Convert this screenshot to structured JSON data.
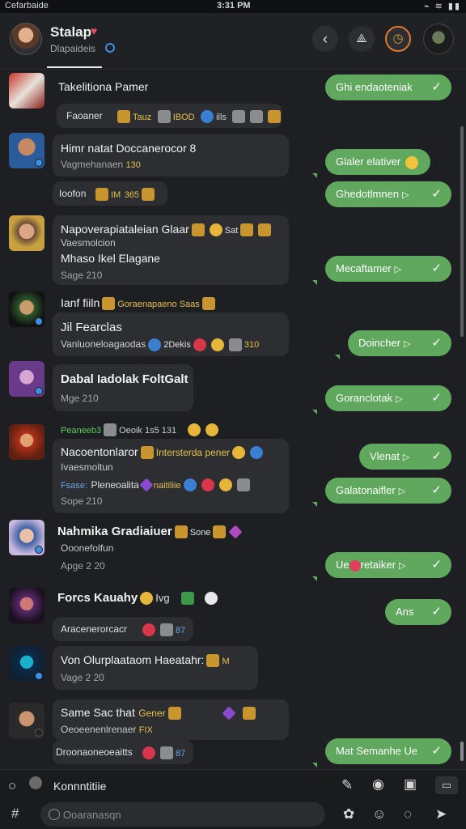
{
  "status_bar": {
    "carrier": "Cefarbaide",
    "time": "3:31 PM",
    "indicators": "⌁ ≋ ▮▮"
  },
  "header": {
    "title": "Stalap",
    "title_emoji": "♥",
    "subtitle": "Dlapaideis",
    "back_icon": "‹",
    "ribbon_icon": "⟁",
    "clock_icon": "◷"
  },
  "messages": [
    {
      "id": 1,
      "name": "Takelitiona Pamer",
      "chips": [
        "Faoaner",
        "Tauz",
        "IBOD",
        "ills"
      ]
    },
    {
      "id": 2,
      "name": "Himr natat Doccanerocor 8",
      "meta": "Vagmehanaen",
      "meta_value": "130",
      "reaction": "Ioofon",
      "reaction_values": [
        "IM",
        "365"
      ]
    },
    {
      "id": 3,
      "name": "Napoverapiataleian Glaar",
      "name_suffix": "Sat",
      "line2": "Vaesmolcion",
      "line3": "Mhaso Ikel Elagane",
      "meta": "Sage 210"
    },
    {
      "id": 4,
      "name": "Ianf fiiln",
      "tag": "Goraenapaeno Saas",
      "line2": "Jil Fearclas",
      "meta": "Vanluoneloagaodas",
      "chip_text": "2Dekis",
      "meta_value": "310"
    },
    {
      "id": 5,
      "name": "Dabal Iadolak FoltGalt",
      "meta": "Mge 210"
    },
    {
      "id": 6,
      "top_chip": "Peaneeb3",
      "top_chip2": "Oeoik 1s5 131",
      "name": "Nacoentonlaror",
      "name_suffix": "Intersterda pener",
      "line2": "Ivaesmoltun",
      "chip3_label": "Fsase:",
      "chip3_text": "Pleneoalita",
      "chip3_suffix": "naitiliie",
      "meta": "Sope 210"
    },
    {
      "id": 7,
      "name": "Nahmika Gradiaiuer",
      "name_suffix": "Sone",
      "line2": "Ooonefolfun",
      "meta": "Apge 2 20"
    },
    {
      "id": 8,
      "name": "Forcs Kauahy",
      "name_suffix": "Ivg"
    },
    {
      "id": 9,
      "reaction": "Aracenerorcacr",
      "reaction_value": "87"
    },
    {
      "id": 10,
      "name": "Von Olurplaataom Haeatahr:",
      "name_suffix": "M",
      "meta": "Vage 2 20"
    },
    {
      "id": 11,
      "name": "Same Sac that",
      "name_suffix": "Gener",
      "line2": "Oeoeenenlrenaer",
      "line2_value": "FIX"
    },
    {
      "id": 12,
      "reaction": "Droonaoneoeaitts",
      "reaction_value": "87"
    }
  ],
  "outgoing": [
    {
      "text": "Ghi endaoteniak",
      "has_play": false,
      "has_smile": false
    },
    {
      "text": "Glaler elativer",
      "has_play": false,
      "has_smile": true
    },
    {
      "text": "Ghedotlmnen",
      "has_play": true,
      "has_smile": false
    },
    {
      "text": "Mecaftamer",
      "has_play": true,
      "has_smile": false
    },
    {
      "text": "Doincher",
      "has_play": true,
      "has_smile": false
    },
    {
      "text": "Goranclotak",
      "has_play": true,
      "has_smile": false
    },
    {
      "text": "Vlenat",
      "has_play": true,
      "has_smile": false
    },
    {
      "text": "Galatonaifler",
      "has_play": true,
      "has_smile": false
    },
    {
      "text": "retaiker",
      "prefix": "Ue",
      "has_play": true,
      "has_smile": false
    },
    {
      "text": "Ans",
      "has_play": false,
      "has_smile": false
    },
    {
      "text": "Mat Semanhe Ue",
      "has_play": false,
      "has_smile": false
    }
  ],
  "bottom_bar": {
    "label": "Konnntitiie",
    "placeholder": "Ooaranasqn",
    "icons": [
      "pen-icon",
      "record-icon",
      "save-icon",
      "folder-icon",
      "grid-icon",
      "emoji-icon",
      "attach-icon",
      "send-icon"
    ]
  },
  "colors": {
    "background": "#1d1f22",
    "incoming_bubble": "#2c2e32",
    "outgoing_bubble": "#5fa85e",
    "accent_orange": "#e0782f",
    "link_blue": "#3d8ee0"
  }
}
